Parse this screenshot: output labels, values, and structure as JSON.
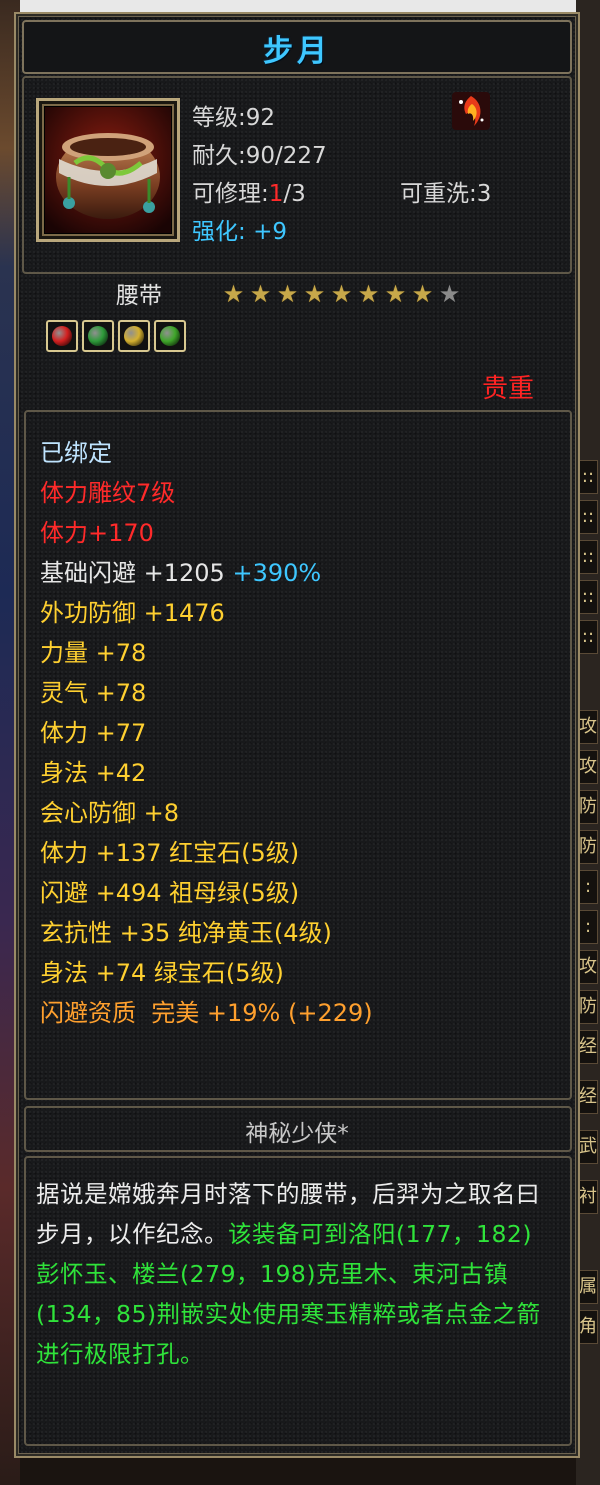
{
  "title": "步月",
  "header": {
    "level": "等级:92",
    "durability": "耐久:90/227",
    "repair_label": "可修理:",
    "repair_current": "1",
    "repair_total": "/3",
    "reroll": "可重洗:3",
    "enhance_label": "强化:",
    "enhance_value": "+9"
  },
  "item_type": "腰带",
  "stars": {
    "total": 9,
    "filled": 8
  },
  "gems": [
    {
      "icon": "red-gem-icon",
      "color": "#d42020"
    },
    {
      "icon": "emerald-gem-icon",
      "color": "#2e9a3a"
    },
    {
      "icon": "yellow-jade-gem-icon",
      "color": "#d4b030"
    },
    {
      "icon": "green-gem-icon",
      "color": "#3fa62a"
    }
  ],
  "rarity": "贵重",
  "stats": {
    "bound": "已绑定",
    "engrave": "体力雕纹7级",
    "engrave_bonus": "体力+170",
    "base_dodge": "基础闪避 +1205",
    "base_dodge_pct": "+390%",
    "outer_def": "外功防御 +1476",
    "strength": "力量 +78",
    "spirit": "灵气 +78",
    "stamina": "体力 +77",
    "agility": "身法 +42",
    "crit_def": "会心防御 +8",
    "gem_line_1": "体力 +137 红宝石(5级)",
    "gem_line_2": "闪避 +494 祖母绿(5级)",
    "gem_line_3": "玄抗性 +35 纯净黄玉(4级)",
    "gem_line_4": "身法 +74 绿宝石(5级)",
    "quality": "闪避资质  完美 +19% (+229)"
  },
  "maker": "神秘少侠*",
  "description": {
    "lore": "据说是嫦娥奔月时落下的腰带，后羿为之取名曰步月，以作纪念。",
    "hint": "该装备可到洛阳(177，182)彭怀玉、楼兰(279，198)克里木、束河古镇(134，85)荆嵌实处使用寒玉精粹或者点金之箭进行极限打孔。"
  },
  "right_edge": [
    "::",
    "::",
    "::",
    "::",
    "::",
    "攻",
    "攻",
    "防",
    "防",
    ":",
    ":",
    "攻",
    "防",
    "经",
    "经",
    "武",
    "衬",
    "属",
    "角"
  ],
  "colors": {
    "title": "#3ec7ff",
    "precious": "#ff2323",
    "stat_yellow": "#ffd030",
    "stat_orange": "#ffa02e",
    "hint_green": "#2fe33a"
  }
}
